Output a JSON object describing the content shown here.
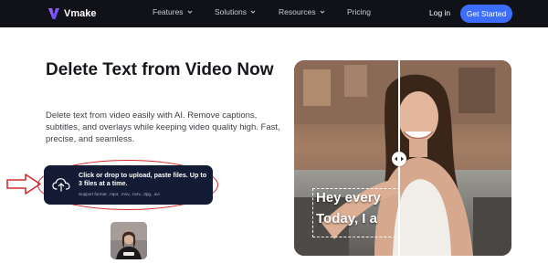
{
  "nav": {
    "brand": "Vmake",
    "items": [
      {
        "label": "Features",
        "dropdown": true
      },
      {
        "label": "Solutions",
        "dropdown": true
      },
      {
        "label": "Resources",
        "dropdown": true
      },
      {
        "label": "Pricing",
        "dropdown": false
      }
    ],
    "login": "Log in",
    "cta": "Get Started"
  },
  "hero": {
    "title": "Delete Text from Video Now",
    "description": "Delete text from video easily with AI. Remove captions, subtitles, and overlays while keeping video quality high. Fast, precise, and seamless."
  },
  "upload": {
    "main_text": "Click or drop to upload, paste files. Up to 3 files at a time.",
    "support_text": "Support format: .mp4, .mov, .m4v, .3pg, .avi"
  },
  "compare": {
    "caption_line1": "Hey every",
    "caption_line2": "Today, I a"
  },
  "colors": {
    "nav_bg": "#111217",
    "accent": "#3d6dff",
    "upload_bg": "#141b35",
    "annotation": "#d32a2a"
  },
  "icons": {
    "logo": "vmake-logo-icon",
    "upload": "cloud-upload-icon",
    "handle": "compare-handle-icon"
  }
}
